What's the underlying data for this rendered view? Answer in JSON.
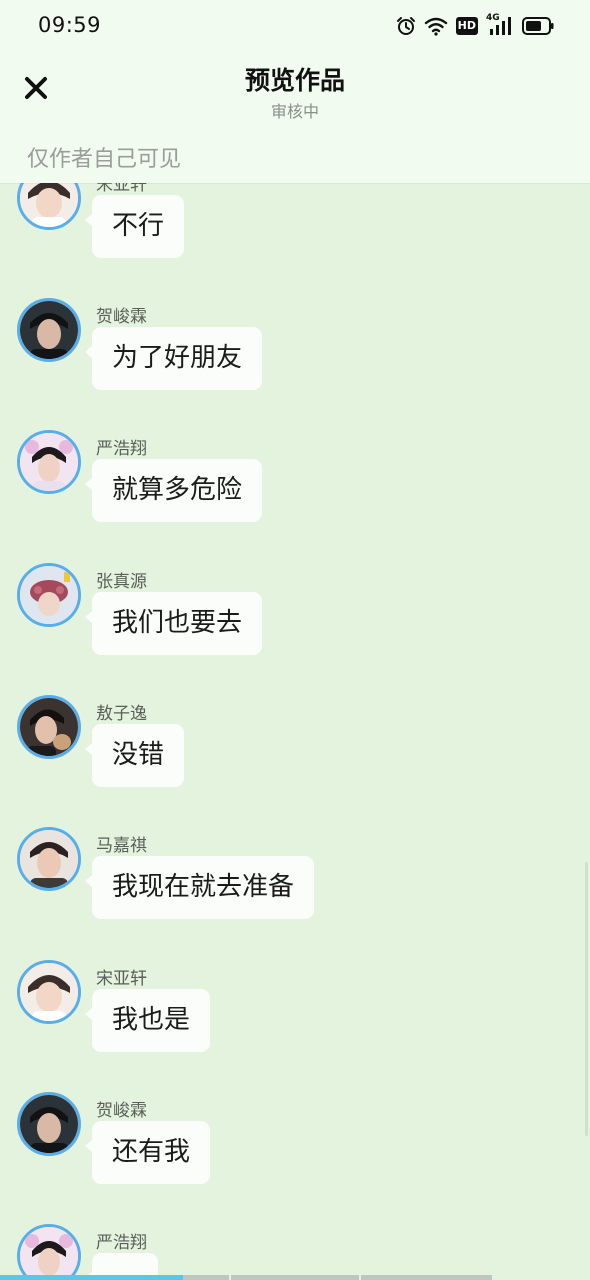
{
  "status_bar": {
    "time": "09:59",
    "icons": [
      "alarm-icon",
      "wifi-icon",
      "hd-icon",
      "signal-4g-icon",
      "battery-icon"
    ],
    "hd_label": "HD",
    "network_label": "4G"
  },
  "nav": {
    "close_icon": "close-icon",
    "title": "预览作品",
    "subtitle": "审核中"
  },
  "visibility_note": "仅作者自己可见",
  "messages": [
    {
      "sender": "宋亚轩",
      "text": "不行"
    },
    {
      "sender": "贺峻霖",
      "text": "为了好朋友"
    },
    {
      "sender": "严浩翔",
      "text": "就算多危险"
    },
    {
      "sender": "张真源",
      "text": "我们也要去"
    },
    {
      "sender": "敖子逸",
      "text": "没错"
    },
    {
      "sender": "马嘉祺",
      "text": "我现在就去准备"
    },
    {
      "sender": "宋亚轩",
      "text": "我也是"
    },
    {
      "sender": "贺峻霖",
      "text": "还有我"
    },
    {
      "sender": "严浩翔",
      "text": "…"
    }
  ],
  "colors": {
    "background": "#e3f3dd",
    "header": "#f1fbef",
    "bubble": "#fafdf9",
    "avatar_ring": "#58aeea",
    "progress": "#57c9e8"
  }
}
